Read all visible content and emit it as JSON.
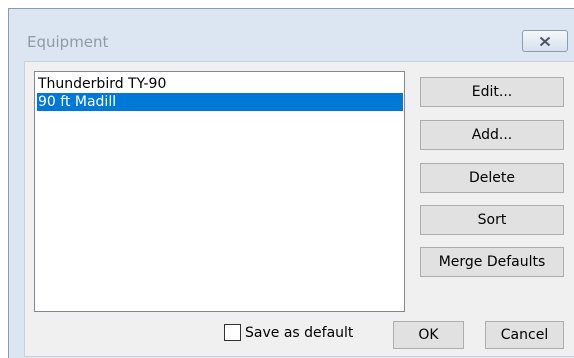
{
  "window": {
    "title": "Equipment"
  },
  "equipment_list": {
    "items": [
      {
        "label": "Thunderbird TY-90",
        "selected": false
      },
      {
        "label": "90 ft Madill",
        "selected": true
      }
    ]
  },
  "side_buttons": {
    "edit": "Edit...",
    "add": "Add...",
    "delete": "Delete",
    "sort": "Sort",
    "merge_defaults": "Merge Defaults"
  },
  "footer": {
    "save_as_default": "Save as default",
    "save_as_default_checked": false,
    "ok": "OK",
    "cancel": "Cancel"
  },
  "colors": {
    "selection": "#0078d7",
    "dialog_frame": "#dbe6f2",
    "client_bg": "#f0f0f0"
  }
}
